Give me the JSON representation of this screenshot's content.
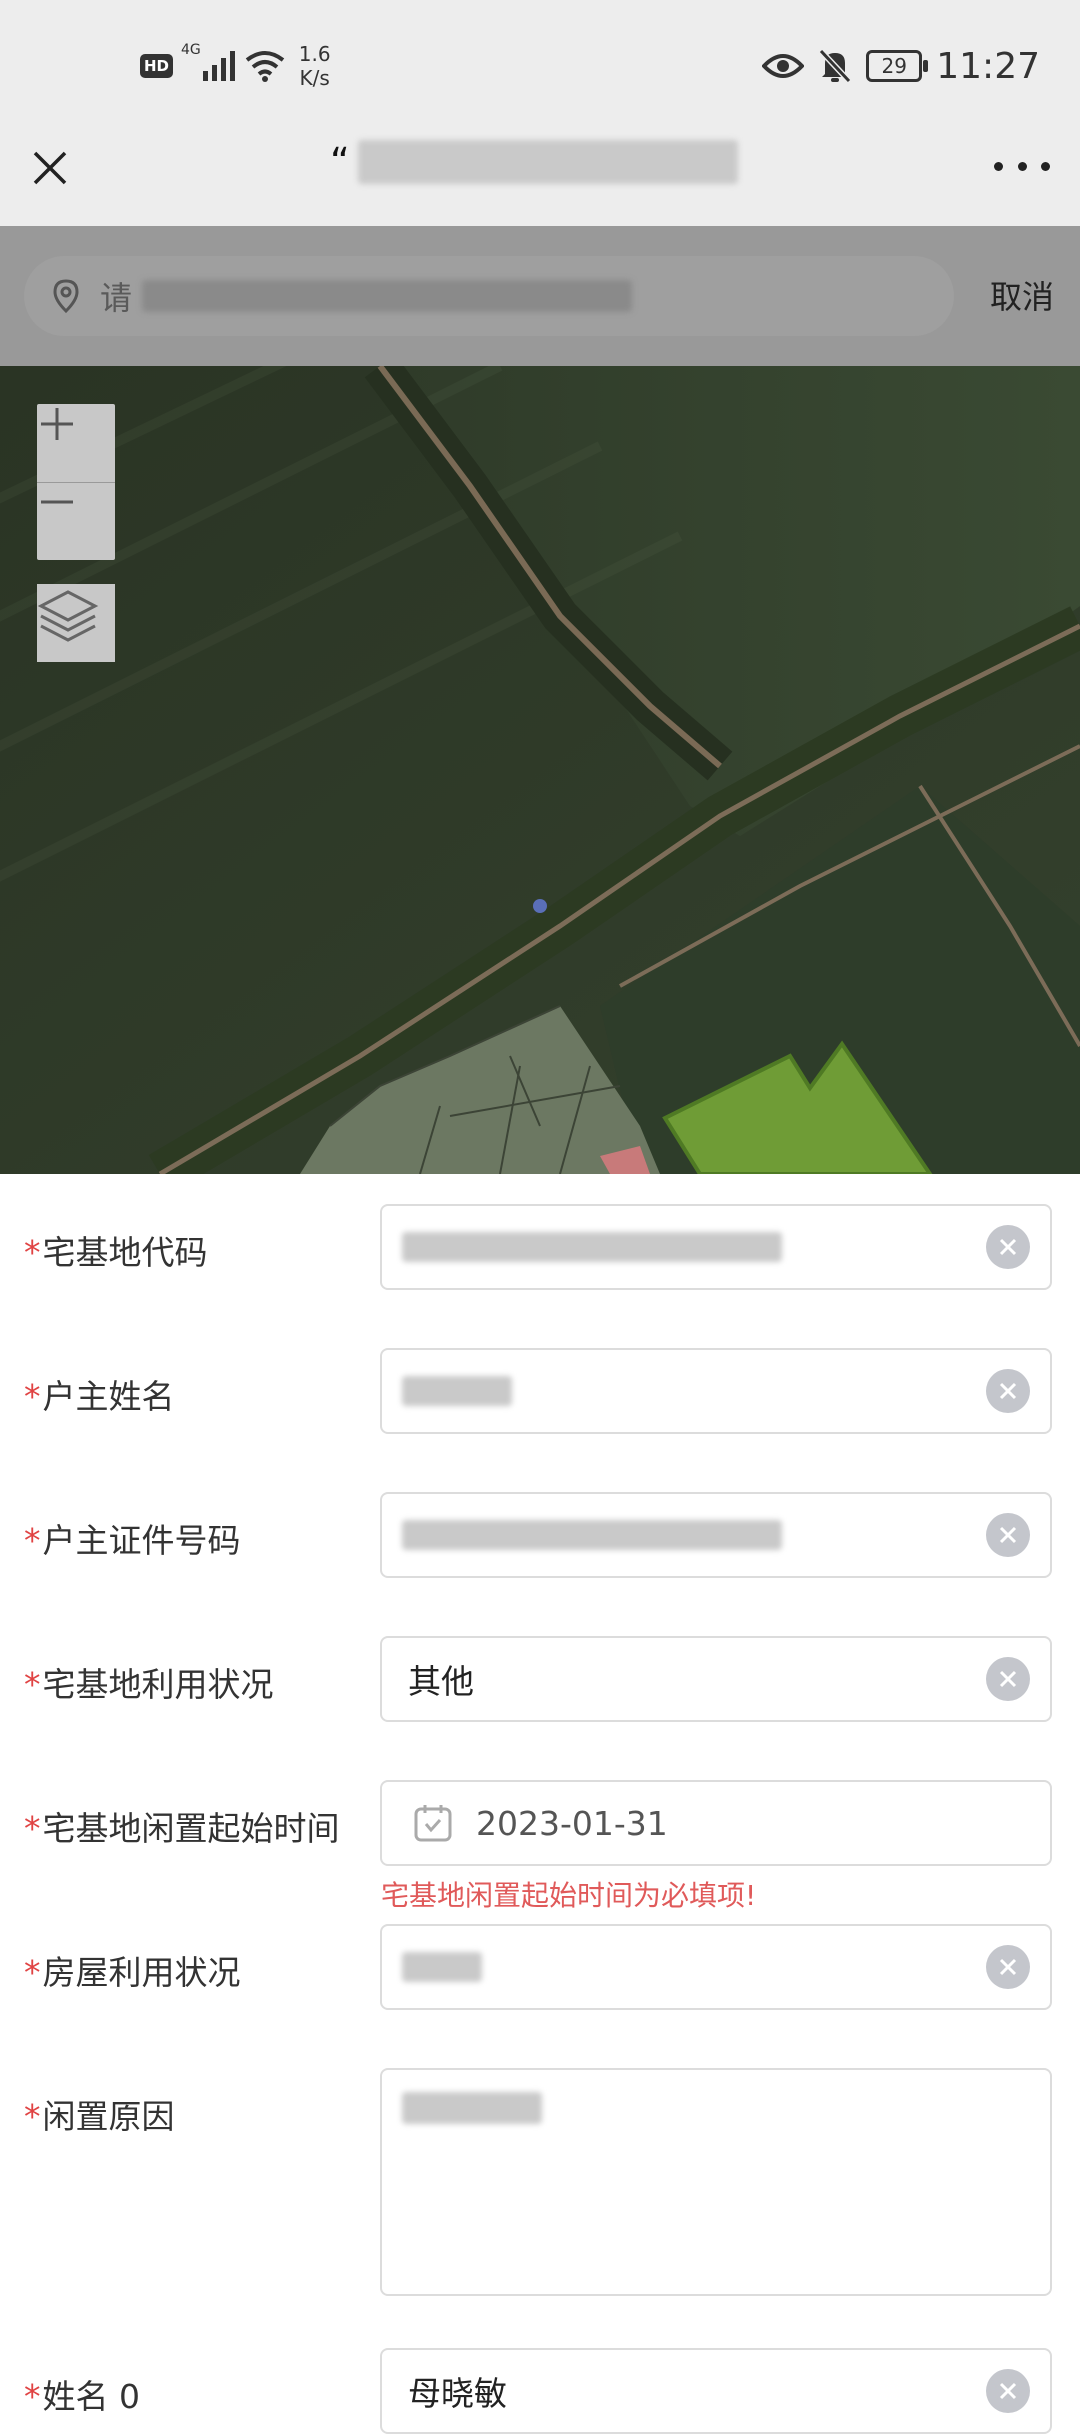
{
  "status_bar": {
    "hd": "HD",
    "network": "4G",
    "speed_value": "1.6",
    "speed_unit": "K/s",
    "battery": "29",
    "time": "11:27"
  },
  "nav": {
    "title_prefix": "“",
    "close_icon": "close-icon",
    "more_icon": "more-icon"
  },
  "search": {
    "placeholder_visible": "请",
    "cancel_label": "取消",
    "icon": "location-pin-icon"
  },
  "map": {
    "controls": {
      "zoom_in": "+",
      "zoom_out": "—",
      "layers_icon": "layers-icon"
    },
    "highlight_color": "#6f9c36"
  },
  "form": {
    "required_mark": "*",
    "fields": [
      {
        "label": "宅基地代码",
        "value": ""
      },
      {
        "label": "户主姓名",
        "value": ""
      },
      {
        "label": "户主证件号码",
        "value": ""
      },
      {
        "label": "宅基地利用状况",
        "value": "其他"
      },
      {
        "label": "宅基地闲置起始时间",
        "value": "2023-01-31",
        "error": "宅基地闲置起始时间为必填项!"
      },
      {
        "label": "房屋利用状况",
        "value": ""
      },
      {
        "label": "闲置原因",
        "value": ""
      },
      {
        "label": "姓名 0",
        "value": "母晓敏"
      }
    ]
  },
  "colors": {
    "required": "#e04343",
    "error": "#e05a5a",
    "map_field": "#6f9c36"
  }
}
